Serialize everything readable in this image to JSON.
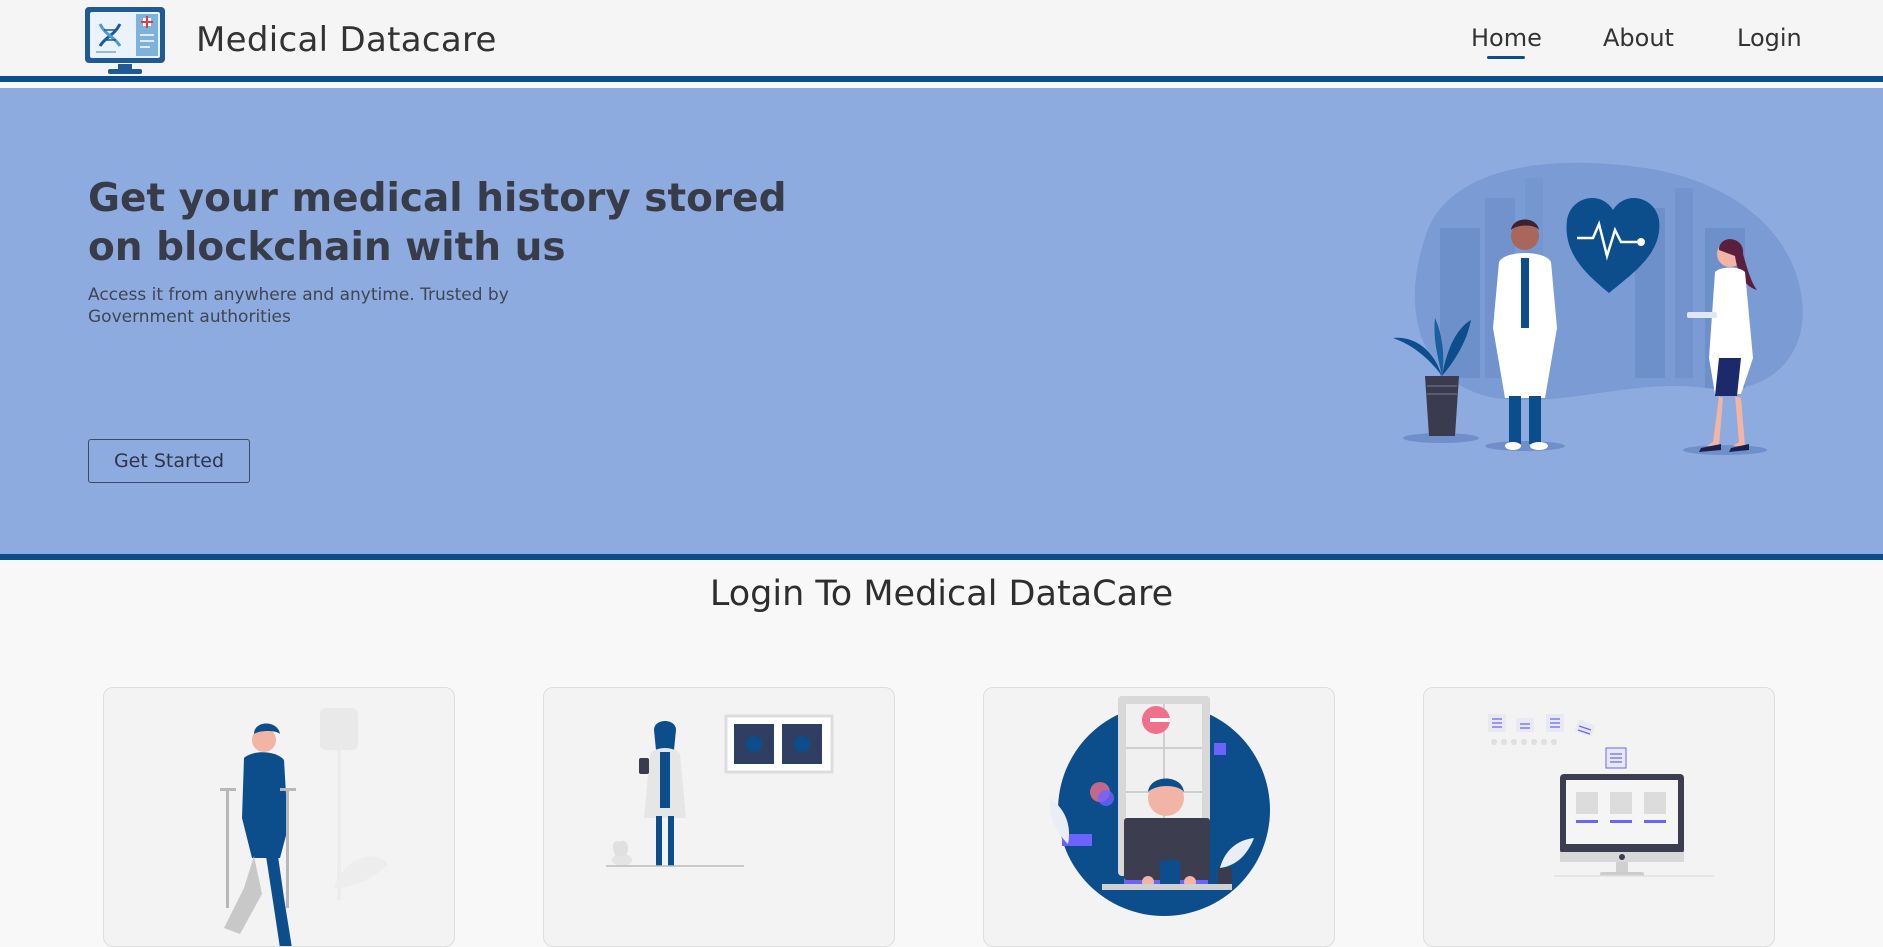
{
  "brand": {
    "name": "Medical Datacare",
    "logo_icon": "dna-monitor-icon"
  },
  "nav": {
    "items": [
      {
        "label": "Home",
        "active": true
      },
      {
        "label": "About"
      },
      {
        "label": "Login"
      }
    ]
  },
  "hero": {
    "title": "Get your medical history stored on blockchain with us",
    "subtitle": "Access it from anywhere and anytime. Trusted by Government authorities",
    "cta_label": "Get Started",
    "illustration": "doctors-heart-illustration"
  },
  "login_section": {
    "title": "Login To Medical DataCare",
    "cards": [
      {
        "illustration": "patient-crutches-illustration"
      },
      {
        "illustration": "doctor-xray-illustration"
      },
      {
        "illustration": "user-laptop-illustration"
      },
      {
        "illustration": "records-monitor-illustration"
      }
    ]
  },
  "colors": {
    "primary": "#0c4d8c",
    "hero_bg": "#8eabe0",
    "page_bg": "#f8f8f8",
    "accent_pink": "#f06f8a",
    "accent_purple": "#6c63ff"
  }
}
